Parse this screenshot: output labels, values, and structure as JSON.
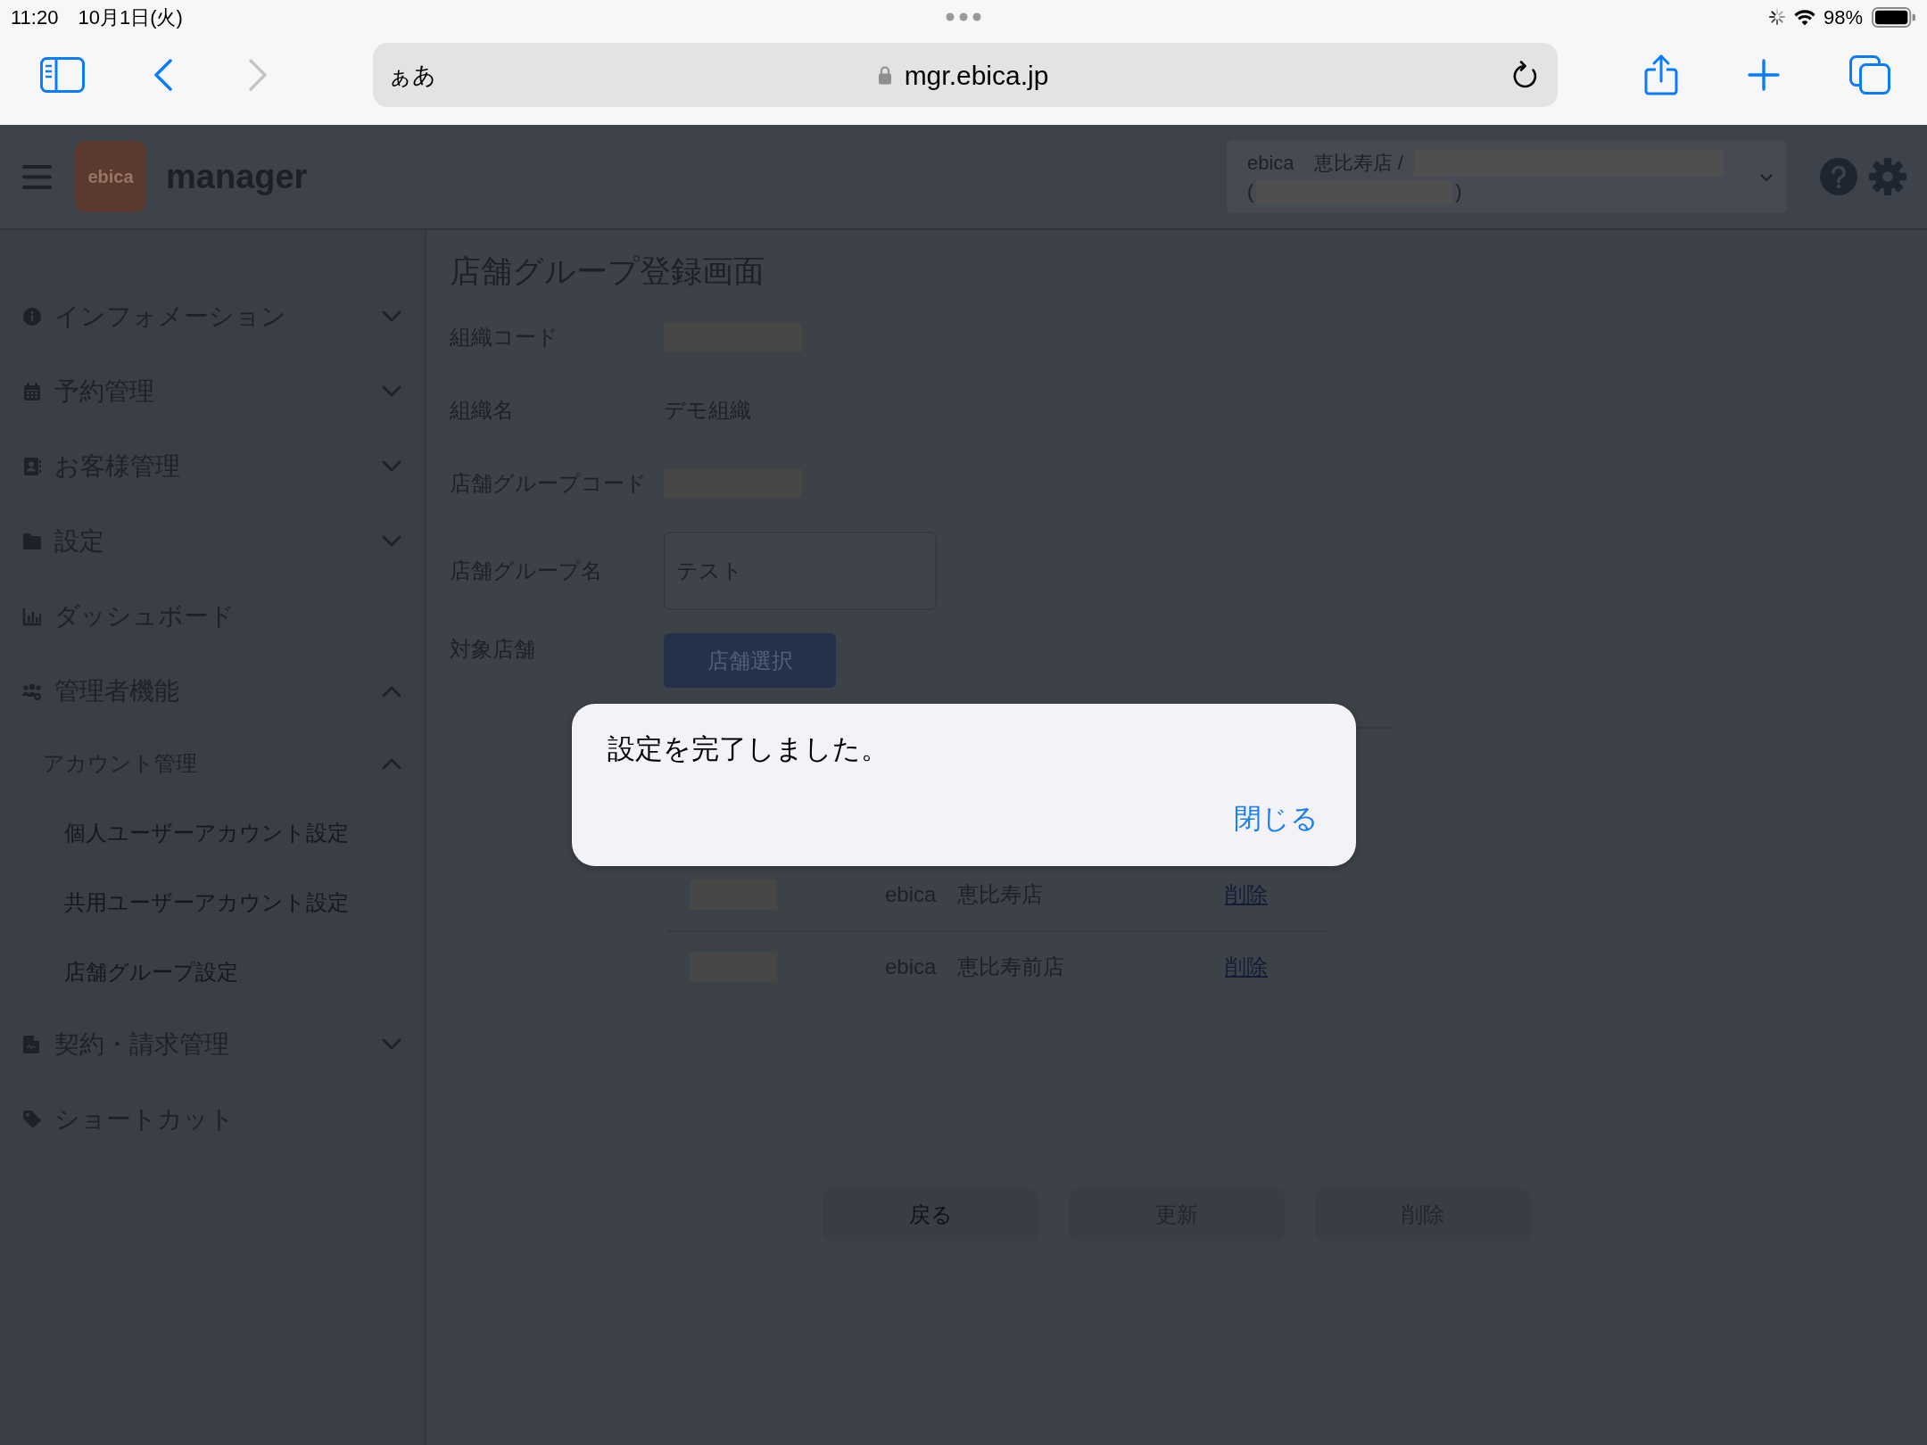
{
  "status_bar": {
    "time": "11:20",
    "date": "10月1日(火)",
    "battery": "98%"
  },
  "browser": {
    "nav": [
      {
        "kind": "back",
        "disabled": false
      },
      {
        "kind": "forward",
        "disabled": true
      }
    ],
    "text_size": "ぁあ",
    "url": "mgr.ebica.jp"
  },
  "header": {
    "logo": "ebica",
    "app_name": "manager",
    "store_selector": {
      "line_1": "ebica　恵比寿店 /",
      "open_paren": "(",
      "close_paren": ")"
    }
  },
  "sidebar": {
    "items": [
      {
        "label": "インフォメーション",
        "expanded": false
      },
      {
        "label": "予約管理",
        "expanded": false
      },
      {
        "label": "お客様管理",
        "expanded": false
      },
      {
        "label": "設定",
        "expanded": false
      },
      {
        "label": "ダッシュボード"
      },
      {
        "label": "管理者機能",
        "expanded": true,
        "children": [
          {
            "label": "アカウント管理",
            "expanded": true,
            "children": [
              {
                "label": "個人ユーザーアカウント設定"
              },
              {
                "label": "共用ユーザーアカウント設定"
              },
              {
                "label": "店舗グループ設定"
              }
            ]
          }
        ]
      },
      {
        "label": "契約・請求管理",
        "expanded": false
      },
      {
        "label": "ショートカット"
      }
    ]
  },
  "page": {
    "title": "店舗グループ登録画面",
    "fields": [
      {
        "label": "組織コード",
        "kind": "redacted"
      },
      {
        "label": "組織名",
        "kind": "text",
        "value": "デモ組織"
      },
      {
        "label": "店舗グループコード",
        "kind": "redacted"
      },
      {
        "label": "店舗グループ名",
        "kind": "input",
        "value": "テスト"
      },
      {
        "label": "対象店舗",
        "kind": "button",
        "button": "店舗選択"
      }
    ],
    "stores": [
      {
        "name": "ebica　恵比寿店",
        "action": "削除"
      },
      {
        "name": "ebica　恵比寿前店",
        "action": "削除"
      }
    ],
    "actions": [
      {
        "label": "戻る",
        "disabled": false
      },
      {
        "label": "更新",
        "disabled": true
      },
      {
        "label": "削除",
        "disabled": true
      }
    ]
  },
  "dialog": {
    "message": "設定を完了しました。",
    "button": "閉じる"
  }
}
